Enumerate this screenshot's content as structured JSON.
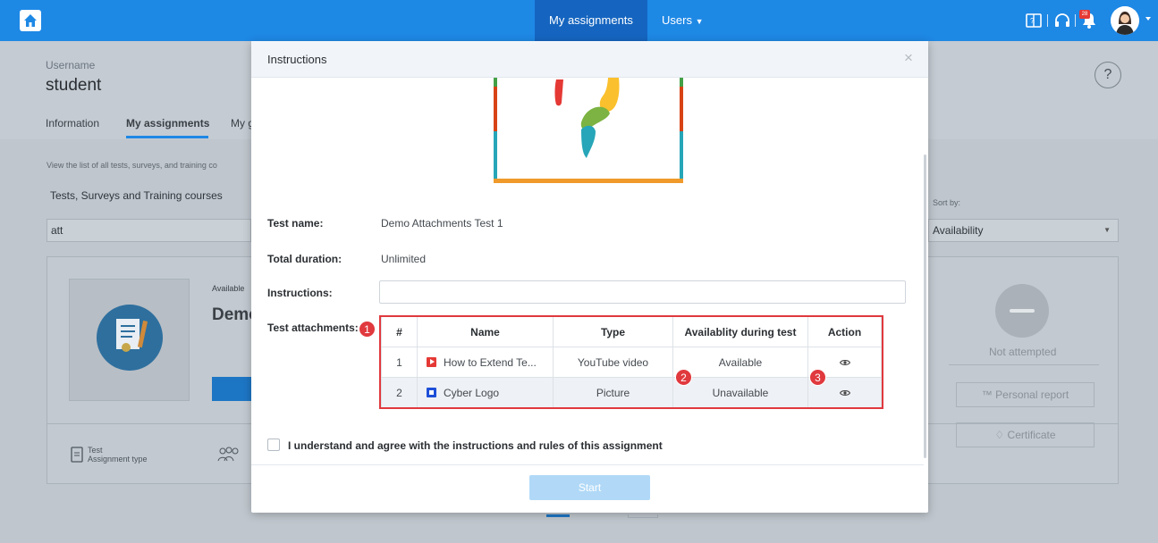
{
  "topbar": {
    "tabs": [
      {
        "label": "My assignments"
      },
      {
        "label": "Users"
      }
    ],
    "notification_count": "28"
  },
  "profile": {
    "username_label": "Username",
    "username": "student",
    "help_label": "?",
    "tabs": [
      {
        "label": "Information"
      },
      {
        "label": "My assignments"
      },
      {
        "label": "My g"
      }
    ]
  },
  "filters": {
    "hint": "View the list of all tests, surveys, and training co",
    "type_select": "Tests, Surveys and Training courses",
    "search_value": "att",
    "sort_label": "Sort by:",
    "sort_value": "Availability"
  },
  "card": {
    "available_label": "Available",
    "title_partial": "Demo",
    "status": "Not attempted",
    "personal_report": "Personal report",
    "certificate": "Certificate",
    "footer_type_value": "Test",
    "footer_type_label": "Assignment type"
  },
  "modal": {
    "title": "Instructions",
    "close": "×",
    "fields": {
      "test_name_label": "Test name:",
      "test_name": "Demo Attachments Test 1",
      "duration_label": "Total duration:",
      "duration": "Unlimited",
      "instructions_label": "Instructions:",
      "instructions_value": "",
      "attachments_label": "Test attachments:"
    },
    "attachments": {
      "headers": [
        "#",
        "Name",
        "Type",
        "Availablity during test",
        "Action"
      ],
      "rows": [
        {
          "num": "1",
          "name": "How to Extend Te...",
          "type": "YouTube video",
          "availability": "Available",
          "icon": "youtube-icon"
        },
        {
          "num": "2",
          "name": "Cyber Logo",
          "type": "Picture",
          "availability": "Unavailable",
          "icon": "picture-icon"
        }
      ]
    },
    "callouts": [
      "1",
      "2",
      "3"
    ],
    "agree_text": "I understand and agree with the instructions and rules of this assignment",
    "start_label": "Start"
  },
  "colors": {
    "primary": "#1e88e5",
    "highlight": "#e0393e"
  }
}
